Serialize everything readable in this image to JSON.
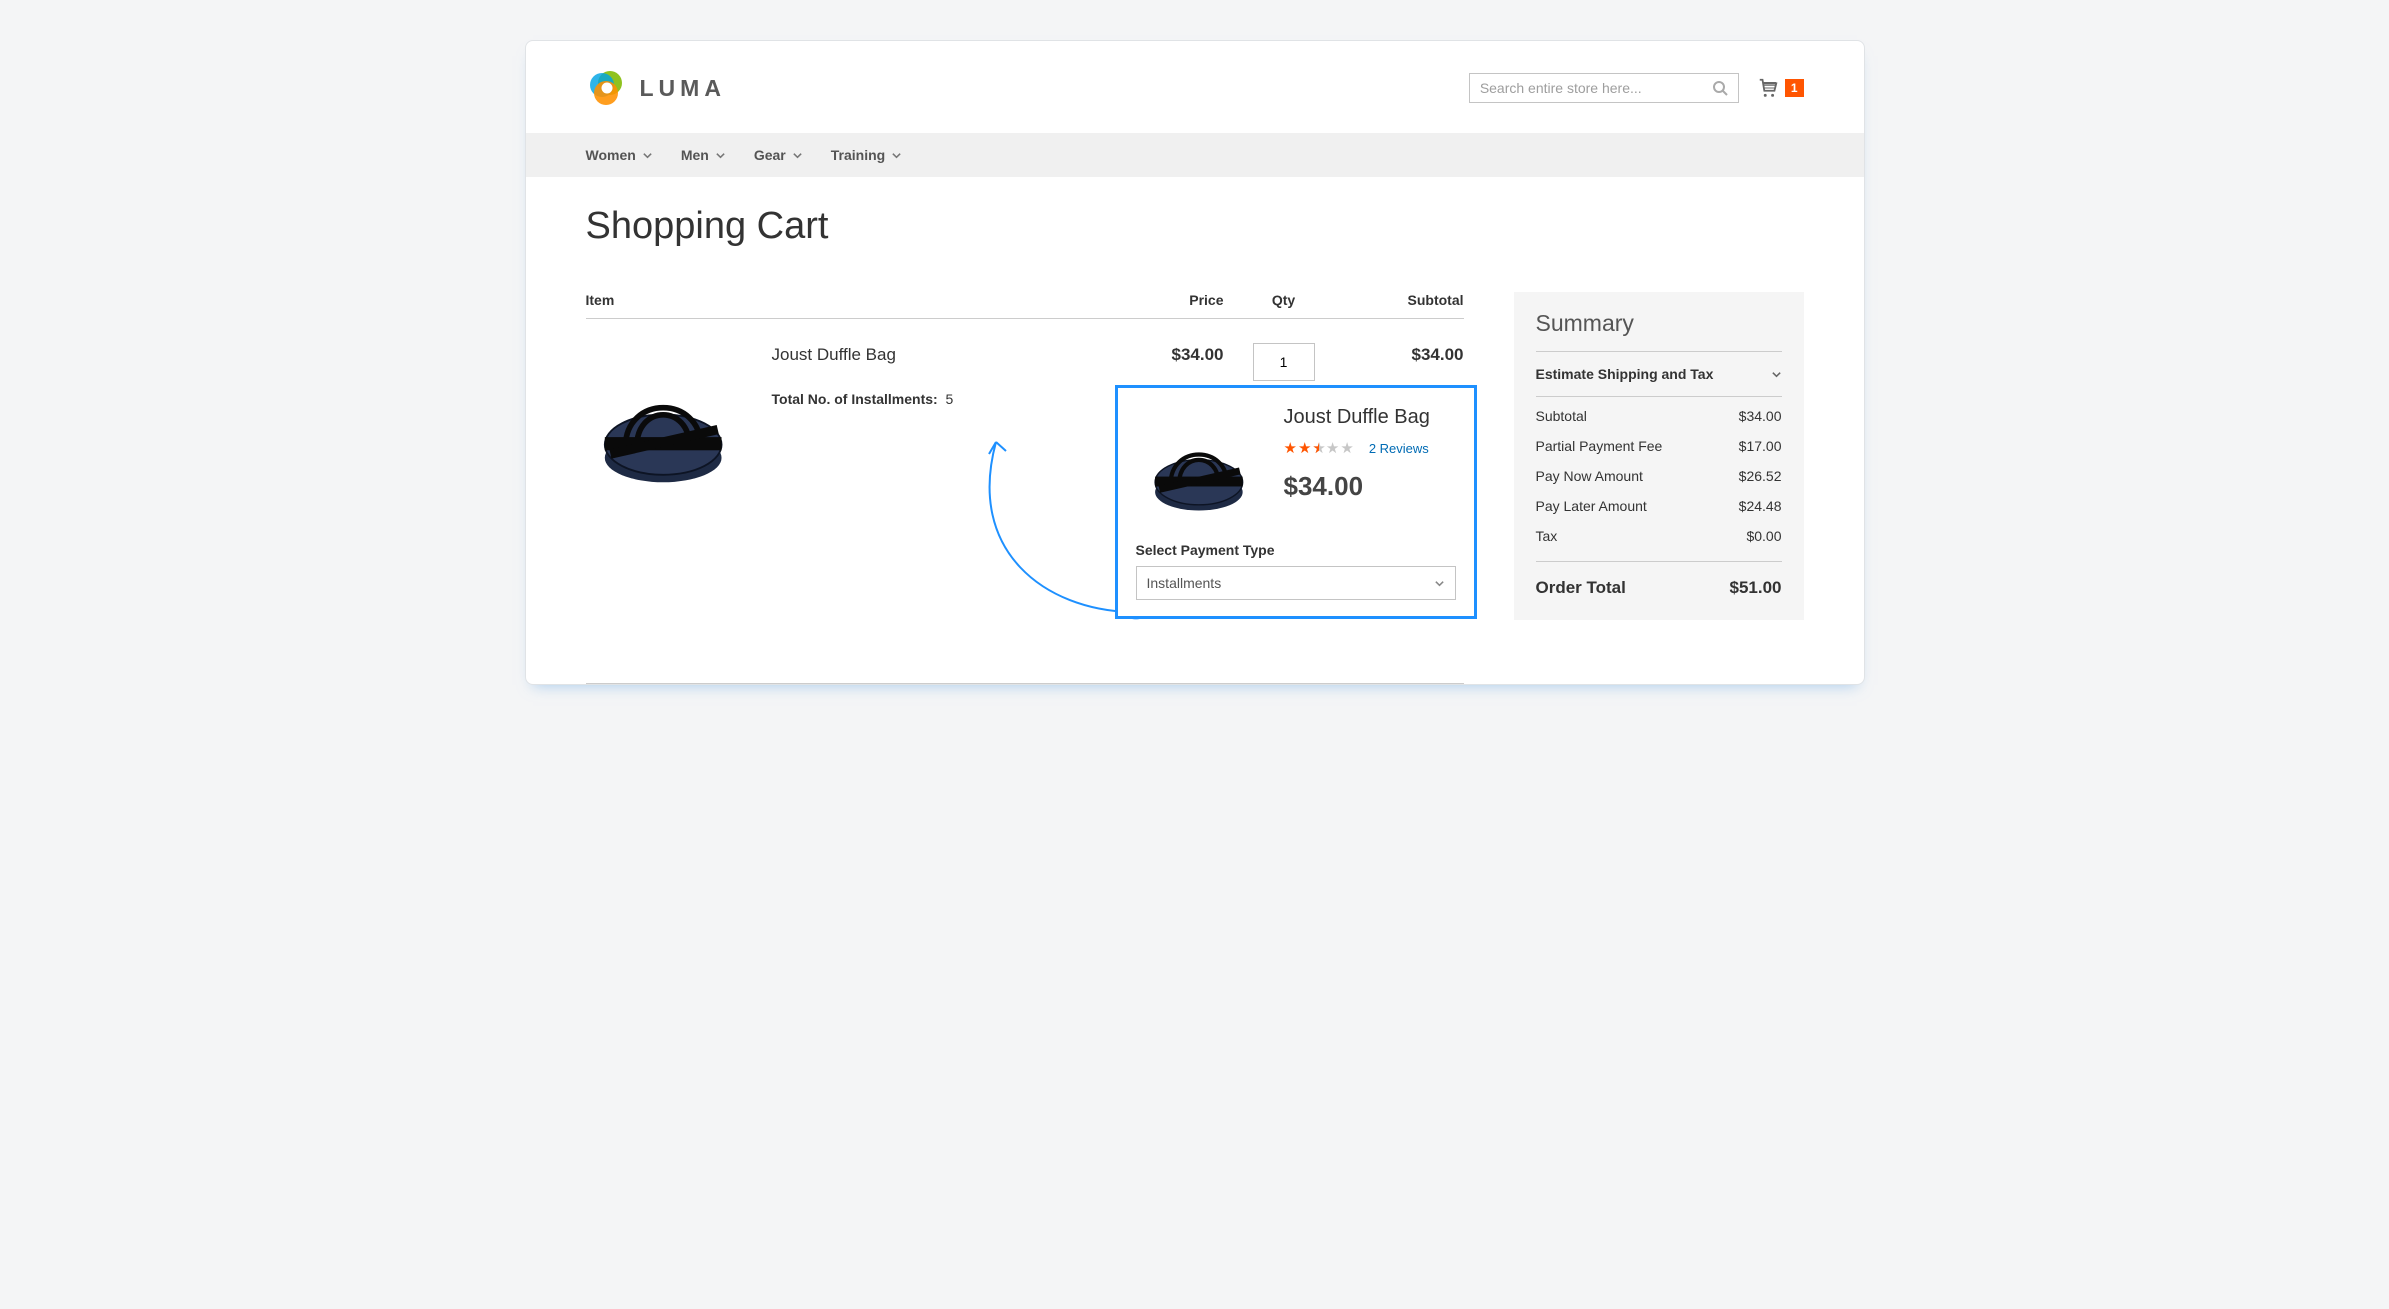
{
  "header": {
    "logo_text": "LUMA",
    "search_placeholder": "Search entire store here...",
    "cart_count": "1"
  },
  "nav": {
    "items": [
      "Women",
      "Men",
      "Gear",
      "Training"
    ]
  },
  "page_title": "Shopping Cart",
  "cart": {
    "headers": {
      "item": "Item",
      "price": "Price",
      "qty": "Qty",
      "subtotal": "Subtotal"
    },
    "row": {
      "name": "Joust Duffle Bag",
      "installments_label": "Total No. of Installments:",
      "installments_value": "5",
      "price": "$34.00",
      "qty": "1",
      "subtotal": "$34.00"
    }
  },
  "popover": {
    "product_name": "Joust Duffle Bag",
    "reviews_text": "2  Reviews",
    "price": "$34.00",
    "select_label": "Select Payment Type",
    "select_value": "Installments"
  },
  "summary": {
    "title": "Summary",
    "estimate_label": "Estimate Shipping and Tax",
    "lines": [
      {
        "label": "Subtotal",
        "value": "$34.00"
      },
      {
        "label": "Partial Payment Fee",
        "value": "$17.00"
      },
      {
        "label": "Pay Now Amount",
        "value": "$26.52"
      },
      {
        "label": "Pay Later Amount",
        "value": "$24.48"
      },
      {
        "label": "Tax",
        "value": "$0.00"
      }
    ],
    "total_label": "Order Total",
    "total_value": "$51.00"
  }
}
